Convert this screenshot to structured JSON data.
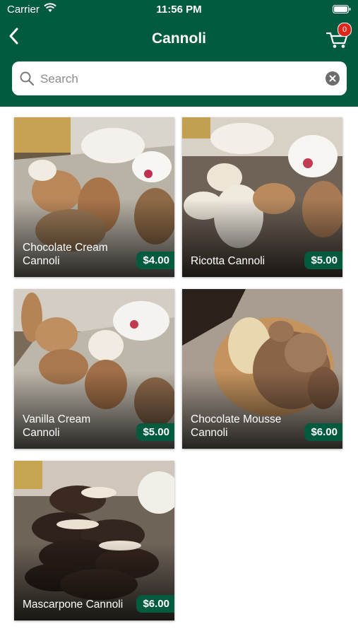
{
  "status_bar": {
    "carrier": "Carrier",
    "time": "11:56 PM"
  },
  "nav": {
    "title": "Cannoli",
    "cart_count": "0",
    "icons": [
      "back-chevron-icon",
      "cart-icon"
    ]
  },
  "search": {
    "placeholder": "Search",
    "value": ""
  },
  "colors": {
    "brand_green": "#035b3f",
    "badge_red": "#e0251d"
  },
  "products": [
    {
      "name": "Chocolate Cream Cannoli",
      "price": "$4.00"
    },
    {
      "name": "Ricotta Cannoli",
      "price": "$5.00"
    },
    {
      "name": "Vanilla Cream Cannoli",
      "price": "$5.00"
    },
    {
      "name": "Chocolate Mousse Cannoli",
      "price": "$6.00"
    },
    {
      "name": "Mascarpone Cannoli",
      "price": "$6.00"
    }
  ]
}
